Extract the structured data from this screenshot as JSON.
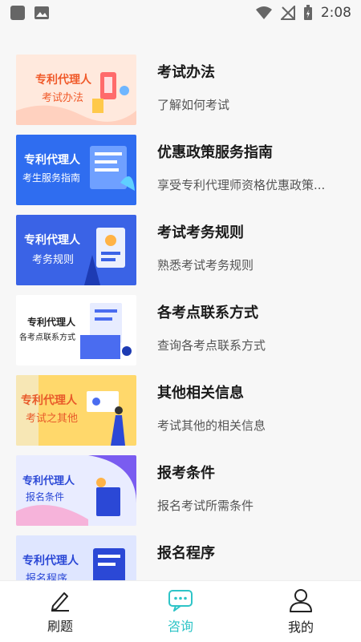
{
  "status_bar": {
    "time": "2:08"
  },
  "items": [
    {
      "thumb_title": "专利代理人",
      "thumb_sub": "考试办法",
      "title": "考试办法",
      "subtitle": "了解如何考试",
      "thumb_bg": "#ffe9dd",
      "thumb_text": "#f05a2a"
    },
    {
      "thumb_title": "专利代理人",
      "thumb_sub": "考生服务指南",
      "title": "优惠政策服务指南",
      "subtitle": "享受专利代理师资格优惠政策...",
      "thumb_bg": "#2f6df0",
      "thumb_text": "#ffffff"
    },
    {
      "thumb_title": "专利代理人",
      "thumb_sub": "考务规则",
      "title": "考试考务规则",
      "subtitle": "熟悉考试考务规则",
      "thumb_bg": "#3a63e6",
      "thumb_text": "#ffffff"
    },
    {
      "thumb_title": "专利代理人",
      "thumb_sub": "各考点联系方式",
      "title": "各考点联系方式",
      "subtitle": "查询各考点联系方式",
      "thumb_bg": "#ffffff",
      "thumb_text": "#222222"
    },
    {
      "thumb_title": "专利代理人",
      "thumb_sub": "考试之其他",
      "title": "其他相关信息",
      "subtitle": "考试其他的相关信息",
      "thumb_bg": "#ffd86b",
      "thumb_text": "#e85a2a"
    },
    {
      "thumb_title": "专利代理人",
      "thumb_sub": "报名条件",
      "title": "报考条件",
      "subtitle": "报名考试所需条件",
      "thumb_bg": "#e9ecff",
      "thumb_text": "#2b48d6"
    },
    {
      "thumb_title": "专利代理人",
      "thumb_sub": "报名程序",
      "title": "报名程序",
      "subtitle": "",
      "thumb_bg": "#dfe6ff",
      "thumb_text": "#2b48d6"
    }
  ],
  "tabs": [
    {
      "label": "刷题",
      "icon": "pencil-icon",
      "active": false
    },
    {
      "label": "咨询",
      "icon": "chat-icon",
      "active": true
    },
    {
      "label": "我的",
      "icon": "user-icon",
      "active": false
    }
  ],
  "colors": {
    "accent": "#2ec4c7",
    "text": "#1a1a1a",
    "muted": "#555555"
  }
}
